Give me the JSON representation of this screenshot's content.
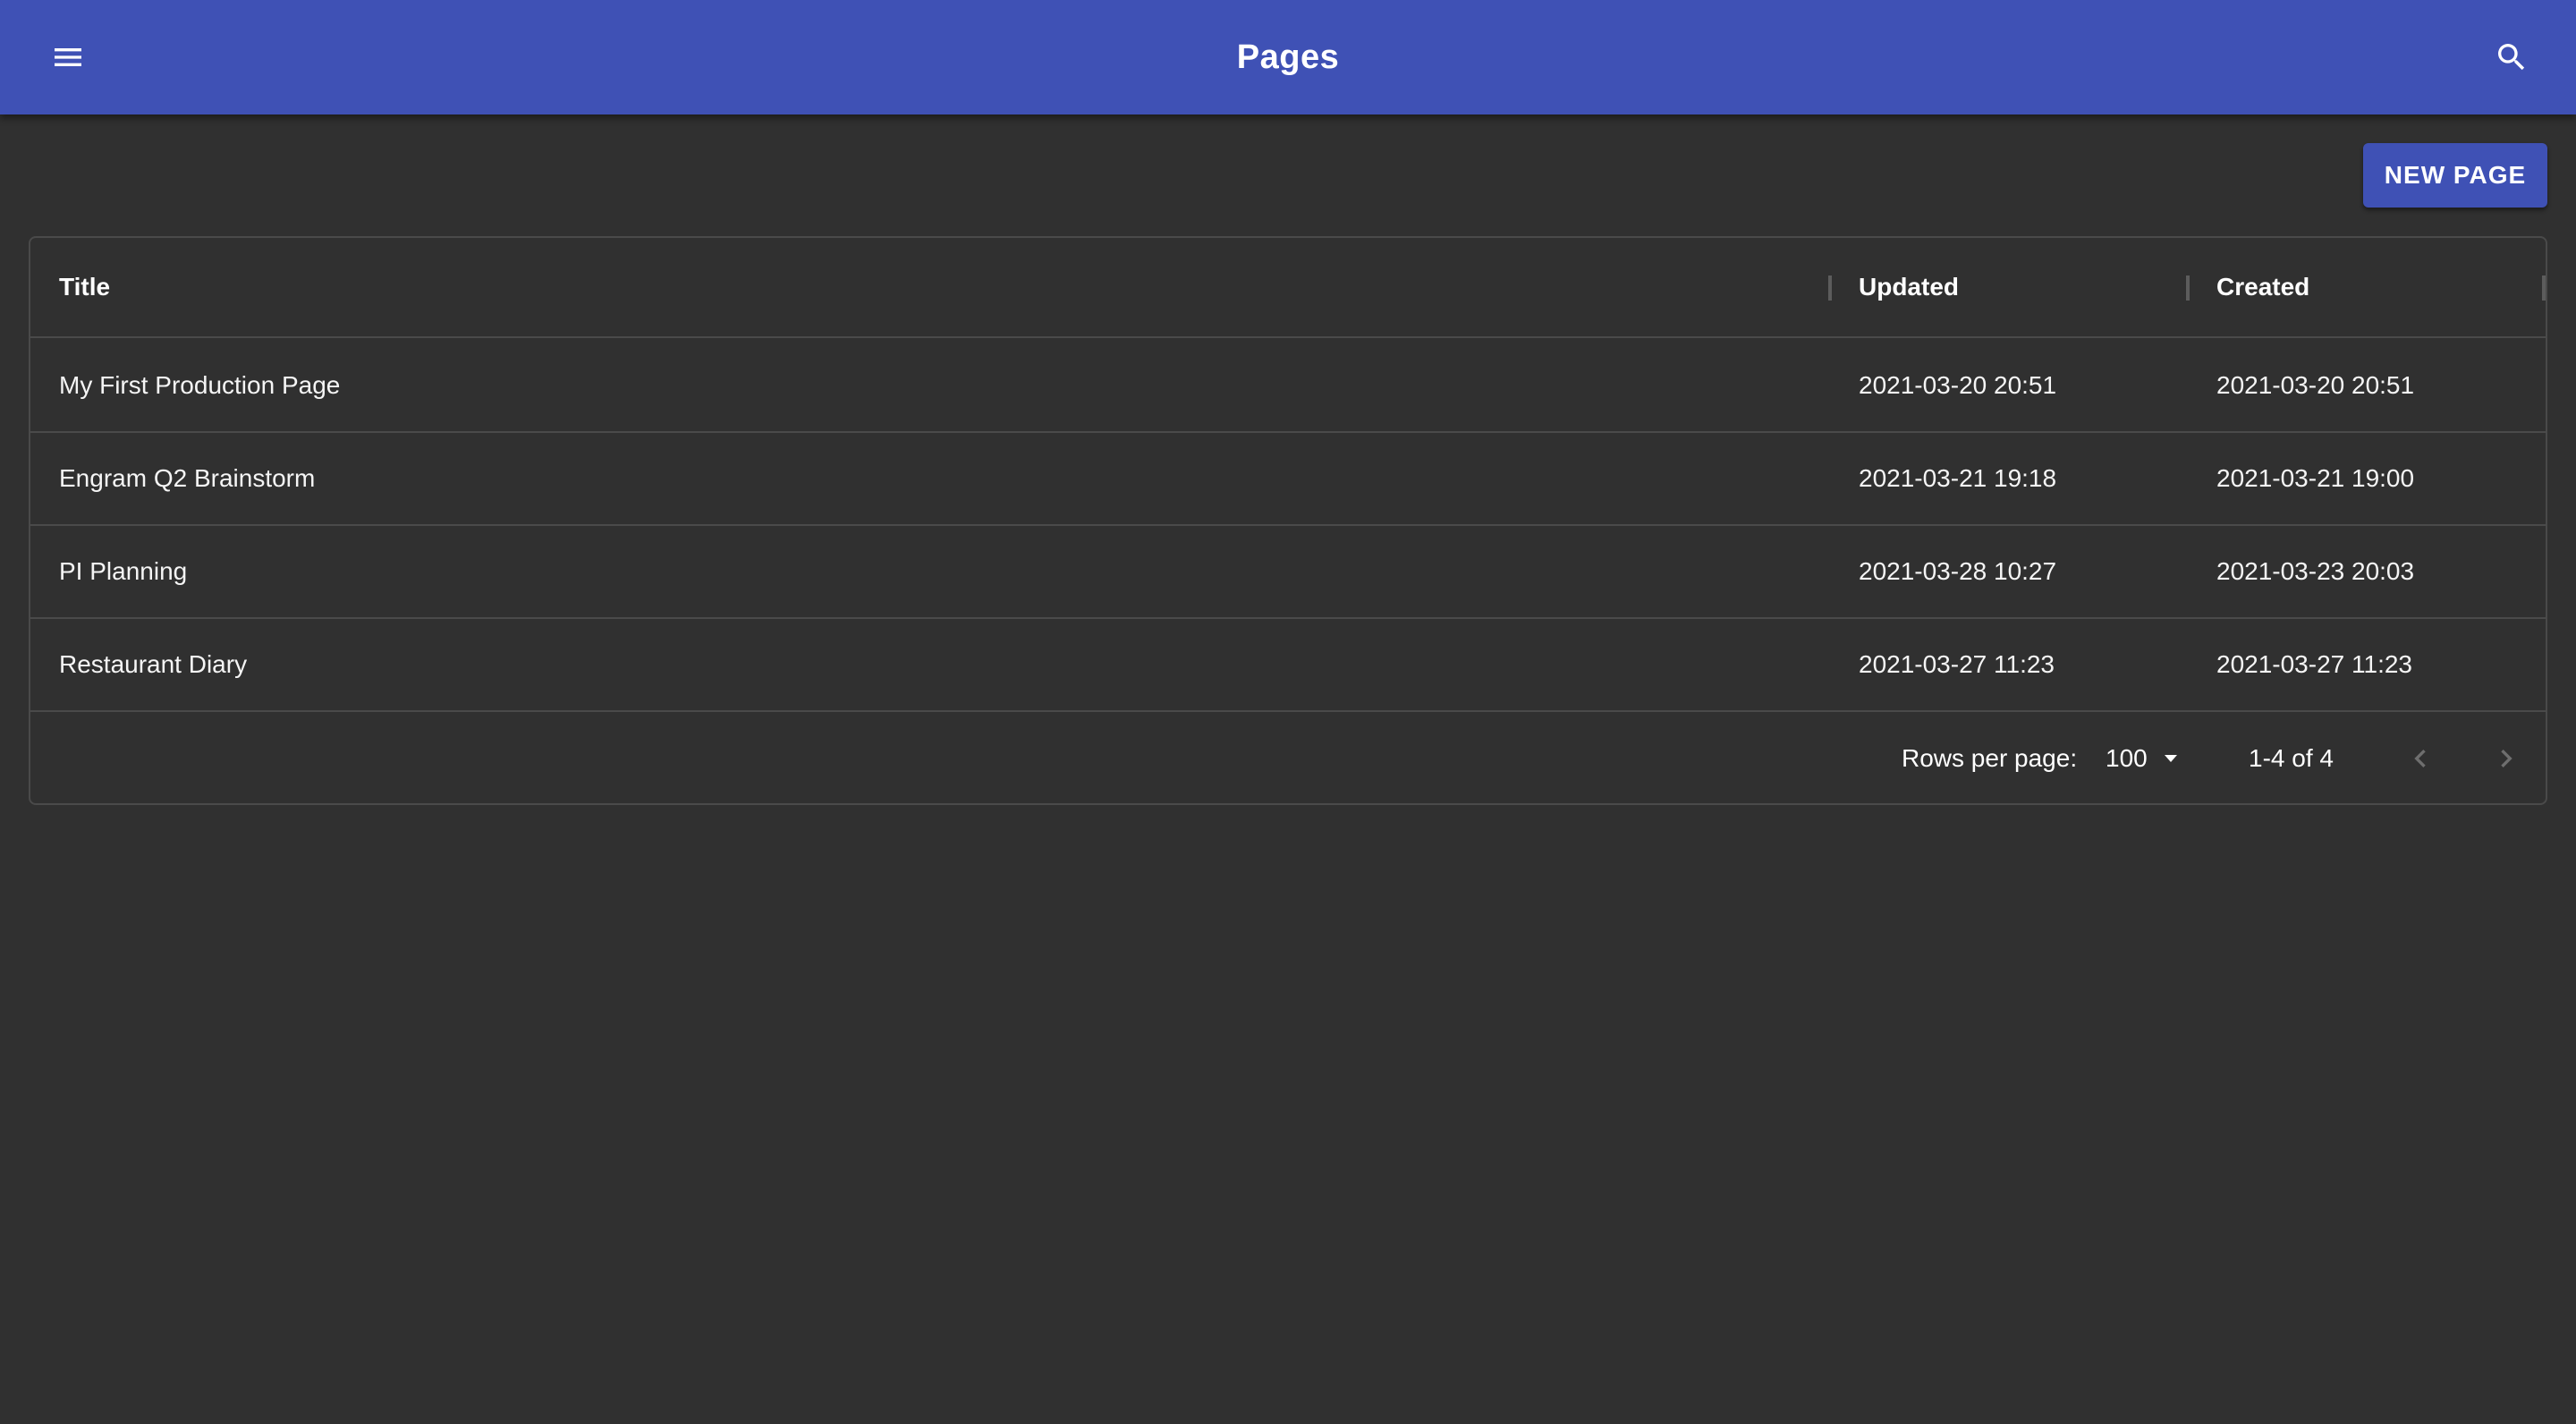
{
  "app_bar": {
    "title": "Pages",
    "menu_icon": "menu-icon",
    "search_icon": "search-icon",
    "color": "#3f51b5"
  },
  "toolbar": {
    "new_page_label": "NEW PAGE"
  },
  "table": {
    "columns": [
      "Title",
      "Updated",
      "Created"
    ],
    "rows": [
      [
        "My First Production Page",
        "2021-03-20 20:51",
        "2021-03-20 20:51"
      ],
      [
        "Engram Q2 Brainstorm",
        "2021-03-21 19:18",
        "2021-03-21 19:00"
      ],
      [
        "PI Planning",
        "2021-03-28 10:27",
        "2021-03-23 20:03"
      ],
      [
        "Restaurant Diary",
        "2021-03-27 11:23",
        "2021-03-27 11:23"
      ]
    ]
  },
  "pagination": {
    "rows_per_page_label": "Rows per page:",
    "rows_per_page_value": "100",
    "range": "1-4 of 4",
    "prev_icon": "chevron-left-icon",
    "next_icon": "chevron-right-icon"
  },
  "colors": {
    "background": "#303030",
    "primary": "#3f51b5",
    "border": "#4a4a4a"
  }
}
